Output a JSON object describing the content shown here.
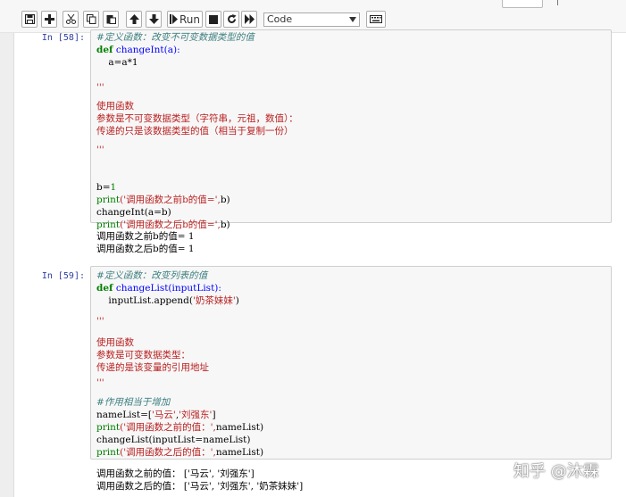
{
  "toolbar": {
    "run_label": "Run",
    "cell_type": "Code",
    "icons": [
      "save-icon",
      "add-icon",
      "cut-icon",
      "copy-icon",
      "paste-icon",
      "move-up-icon",
      "move-down-icon",
      "run-icon",
      "stop-icon",
      "restart-icon",
      "fast-forward-icon",
      "keyboard-icon"
    ]
  },
  "cells": [
    {
      "prompt": "In [58]:",
      "code": {
        "l1": "#定义函数：改变不可变数据类型的值",
        "l2_kw": "def",
        "l2_name": " changeInt(a):",
        "l3": "    a=a*1",
        "l5": "'''",
        "l6": "使用函数",
        "l7": "参数是不可变数据类型（字符串，元祖，数值）：",
        "l8": "传递的只是该数据类型的值（相当于复制一份）",
        "l9": "'''",
        "l12_a": "b=",
        "l12_b": "1",
        "l13_fn": "print",
        "l13_str": "('调用函数之前b的值=',",
        "l13_rest": "b)",
        "l14": "changeInt(a=b)",
        "l15_fn": "print",
        "l15_str": "('调用函数之后b的值=',",
        "l15_rest": "b)"
      },
      "output": [
        "调用函数之前b的值= 1",
        "调用函数之后b的值= 1"
      ]
    },
    {
      "prompt": "In [59]:",
      "code": {
        "l1": "#定义函数：改变列表的值",
        "l2_kw": "def",
        "l2_name": " changeList(inputList):",
        "l3_a": "    inputList.append(",
        "l3_str": "'奶茶妹妹'",
        "l3_b": ")",
        "l5": "'''",
        "l6": "使用函数",
        "l7": "参数是可变数据类型：",
        "l8": "传递的是该变量的引用地址",
        "l9": "'''",
        "l11": "#作用相当于增加",
        "l12_a": "nameList=[",
        "l12_s1": "'马云'",
        "l12_c": ",",
        "l12_s2": "'刘强东'",
        "l12_b": "]",
        "l13_fn": "print",
        "l13_str": "('调用函数之前的值：',",
        "l13_rest": "nameList)",
        "l14": "changeList(inputList=nameList)",
        "l15_fn": "print",
        "l15_str": "('调用函数之后的值：',",
        "l15_rest": "nameList)"
      },
      "output": [
        "调用函数之前的值： ['马云', '刘强东']",
        "调用函数之后的值： ['马云', '刘强东', '奶茶妹妹']"
      ]
    }
  ],
  "watermark": "知乎 @沐霖"
}
